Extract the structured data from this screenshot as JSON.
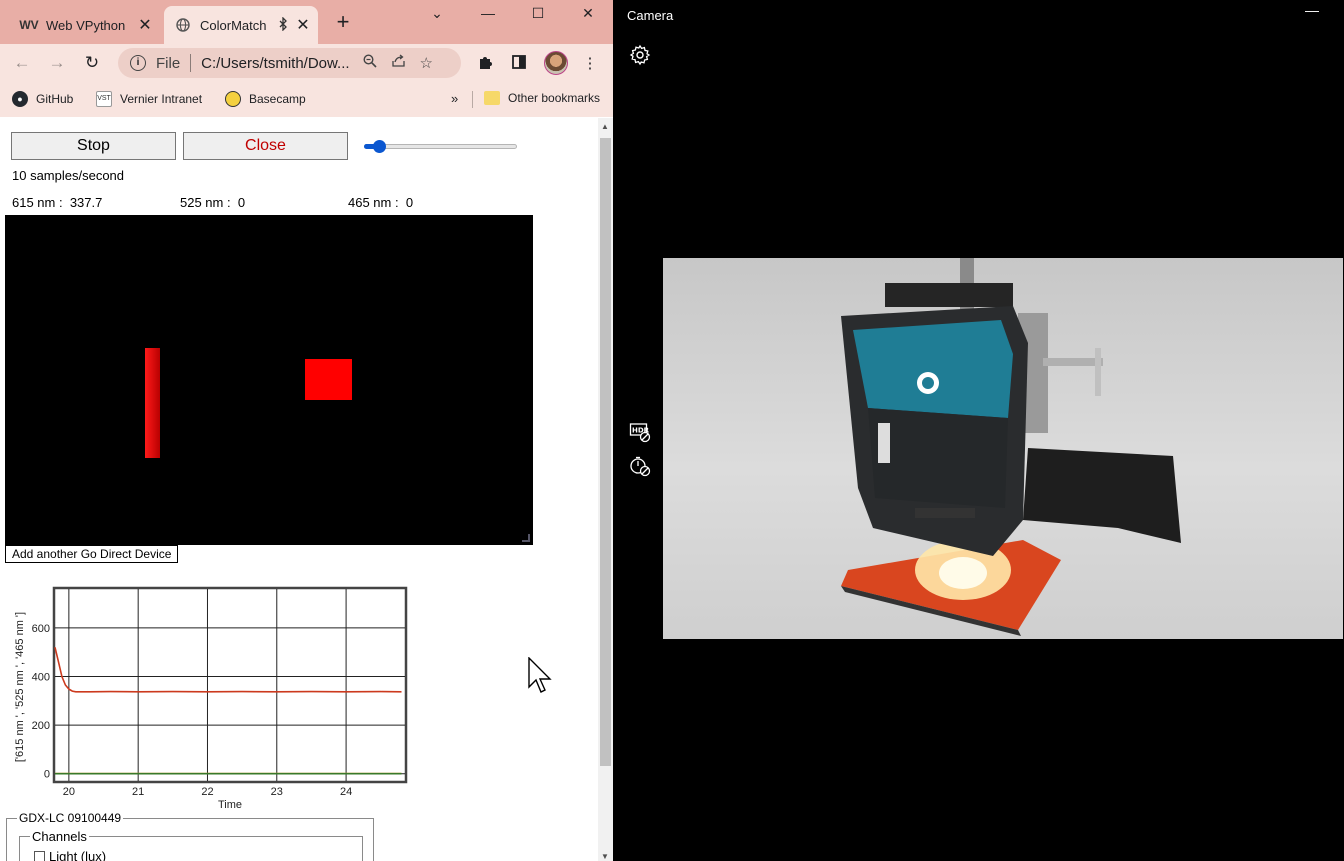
{
  "browser": {
    "tabs": [
      {
        "label": "Web VPython",
        "favicon": "WV"
      },
      {
        "label": "ColorMatch",
        "active": true
      }
    ],
    "window_controls": {
      "search_tabs": "⌄",
      "minimize": "—",
      "maximize": "☐",
      "close": "✕"
    },
    "address": {
      "scheme": "File",
      "url": "C:/Users/tsmith/Dow..."
    },
    "bookmarks": [
      {
        "label": "GitHub"
      },
      {
        "label": "Vernier Intranet",
        "icon_text": "VST"
      },
      {
        "label": "Basecamp"
      }
    ],
    "bookmarks_more": "»",
    "other_bookmarks": "Other bookmarks"
  },
  "page": {
    "stop_label": "Stop",
    "close_label": "Close",
    "rate_slider": {
      "value": 0.1
    },
    "rate_text": "10 samples/second",
    "readings": [
      {
        "label": "615 nm :",
        "value": "337.7"
      },
      {
        "label": "525 nm :",
        "value": "0"
      },
      {
        "label": "465 nm :",
        "value": "0"
      }
    ],
    "add_device_label": "Add another Go Direct Device",
    "device_legend": "GDX-LC 09100449",
    "channels_legend": "Channels",
    "light_channel_label": "Light (lux)"
  },
  "chart_data": {
    "type": "line",
    "xlabel": "Time",
    "ylabel": "['615 nm ', '525 nm ', '465 nm ']",
    "xlim": [
      19.8,
      24.85
    ],
    "ylim": [
      -30,
      760
    ],
    "xticks": [
      20,
      21,
      22,
      23,
      24
    ],
    "yticks": [
      0,
      200,
      400,
      600
    ],
    "grid": true,
    "series": [
      {
        "color": "#cc3a1e",
        "x": [
          19.8,
          19.85,
          19.9,
          19.95,
          20.0,
          20.05,
          20.1,
          20.3,
          20.6,
          21,
          21.5,
          22,
          22.5,
          23,
          23.5,
          24,
          24.5,
          24.8
        ],
        "y": [
          520,
          460,
          400,
          365,
          348,
          340,
          337,
          337,
          338,
          337,
          338,
          337,
          338,
          337,
          338,
          337,
          338,
          337
        ]
      },
      {
        "color": "#3a7a2a",
        "x": [
          19.8,
          20.5,
          21,
          21.5,
          22,
          22.5,
          23,
          23.5,
          24,
          24.5,
          24.8
        ],
        "y": [
          0,
          0,
          0,
          0,
          0,
          0,
          0,
          0,
          0,
          0,
          0
        ]
      },
      {
        "color": "#e0a030",
        "x": [
          19.8,
          20.5,
          21,
          21.5,
          22,
          22.5,
          23,
          23.5,
          24,
          24.5,
          24.8
        ],
        "y": [
          1,
          1,
          1,
          1,
          1,
          1,
          1,
          1,
          1,
          1,
          1
        ]
      }
    ]
  },
  "camera": {
    "title": "Camera",
    "minimize": "—",
    "icons": [
      "settings-icon",
      "hdr-off-icon",
      "timer-off-icon"
    ]
  }
}
